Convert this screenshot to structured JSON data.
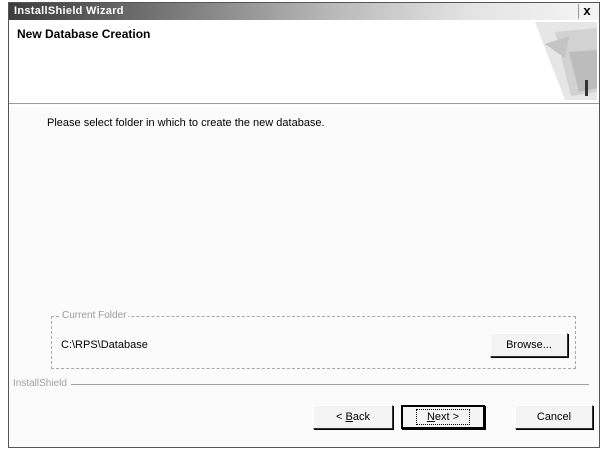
{
  "window": {
    "title": "InstallShield Wizard",
    "close_label": "x"
  },
  "header": {
    "title": "New Database Creation"
  },
  "main": {
    "instruction": "Please select folder in which to create the new database."
  },
  "destination": {
    "legend": "Current Folder",
    "path": "C:\\RPS\\Database",
    "browse_label": "Browse..."
  },
  "footer": {
    "brand": "InstallShield",
    "back_label_prefix": "< ",
    "back_label_key": "B",
    "back_label_rest": "ack",
    "next_label_key": "N",
    "next_label_rest": "ext >",
    "cancel_label": "Cancel"
  }
}
